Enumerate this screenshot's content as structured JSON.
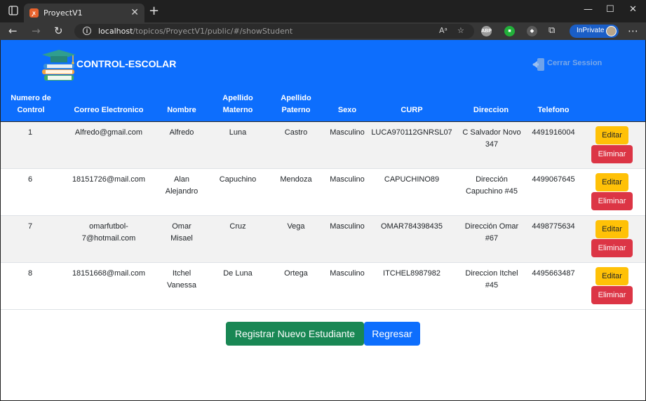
{
  "browser": {
    "tab_title": "ProyectV1",
    "tab_favicon": "xampp-icon",
    "url_host": "localhost",
    "url_path": "/topicos/ProyectV1/public/#/showStudent",
    "inprivate_label": "InPrivate",
    "ext_adblock": "ABP",
    "window_controls": [
      "—",
      "☐",
      "✕"
    ]
  },
  "header": {
    "brand": "CONTROL-ESCOLAR",
    "logout_label": "Cerrar Session",
    "bg_color": "#0d6efd"
  },
  "table": {
    "columns": [
      {
        "l1": "Numero de",
        "l2": "Control"
      },
      {
        "l1": "",
        "l2": "Correo Electronico"
      },
      {
        "l1": "",
        "l2": "Nombre"
      },
      {
        "l1": "Apellido",
        "l2": "Materno"
      },
      {
        "l1": "Apellido",
        "l2": "Paterno"
      },
      {
        "l1": "",
        "l2": "Sexo"
      },
      {
        "l1": "",
        "l2": "CURP"
      },
      {
        "l1": "",
        "l2": "Direccion"
      },
      {
        "l1": "",
        "l2": "Telefono"
      }
    ],
    "rows": [
      {
        "control": "1",
        "email": "Alfredo@gmail.com",
        "nombre": "Alfredo",
        "materno": "Luna",
        "paterno": "Castro",
        "sexo": "Masculino",
        "curp": "LUCA970112GNRSL07",
        "direccion_l1": "C Salvador Novo",
        "direccion_l2": "347",
        "telefono": "4491916004"
      },
      {
        "control": "6",
        "email": "18151726@mail.com",
        "nombre_l1": "Alan",
        "nombre_l2": "Alejandro",
        "materno": "Capuchino",
        "paterno": "Mendoza",
        "sexo": "Masculino",
        "curp": "CAPUCHINO89",
        "direccion_l1": "Dirección",
        "direccion_l2": "Capuchino #45",
        "telefono": "4499067645"
      },
      {
        "control": "7",
        "email_l1": "omarfutbol-",
        "email_l2": "7@hotmail.com",
        "nombre_l1": "Omar",
        "nombre_l2": "Misael",
        "materno": "Cruz",
        "paterno": "Vega",
        "sexo": "Masculino",
        "curp": "OMAR784398435",
        "direccion_l1": "Dirección Omar",
        "direccion_l2": "#67",
        "telefono": "4498775634"
      },
      {
        "control": "8",
        "email": "18151668@mail.com",
        "nombre_l1": "Itchel",
        "nombre_l2": "Vanessa",
        "materno": "De Luna",
        "paterno": "Ortega",
        "sexo": "Masculino",
        "curp": "ITCHEL8987982",
        "direccion_l1": "Direccion Itchel",
        "direccion_l2": "#45",
        "telefono": "4495663487"
      }
    ],
    "edit_label": "Editar",
    "delete_label": "Eliminar"
  },
  "actions": {
    "register_label": "Registrar Nuevo Estudiante",
    "back_label": "Regresar"
  }
}
